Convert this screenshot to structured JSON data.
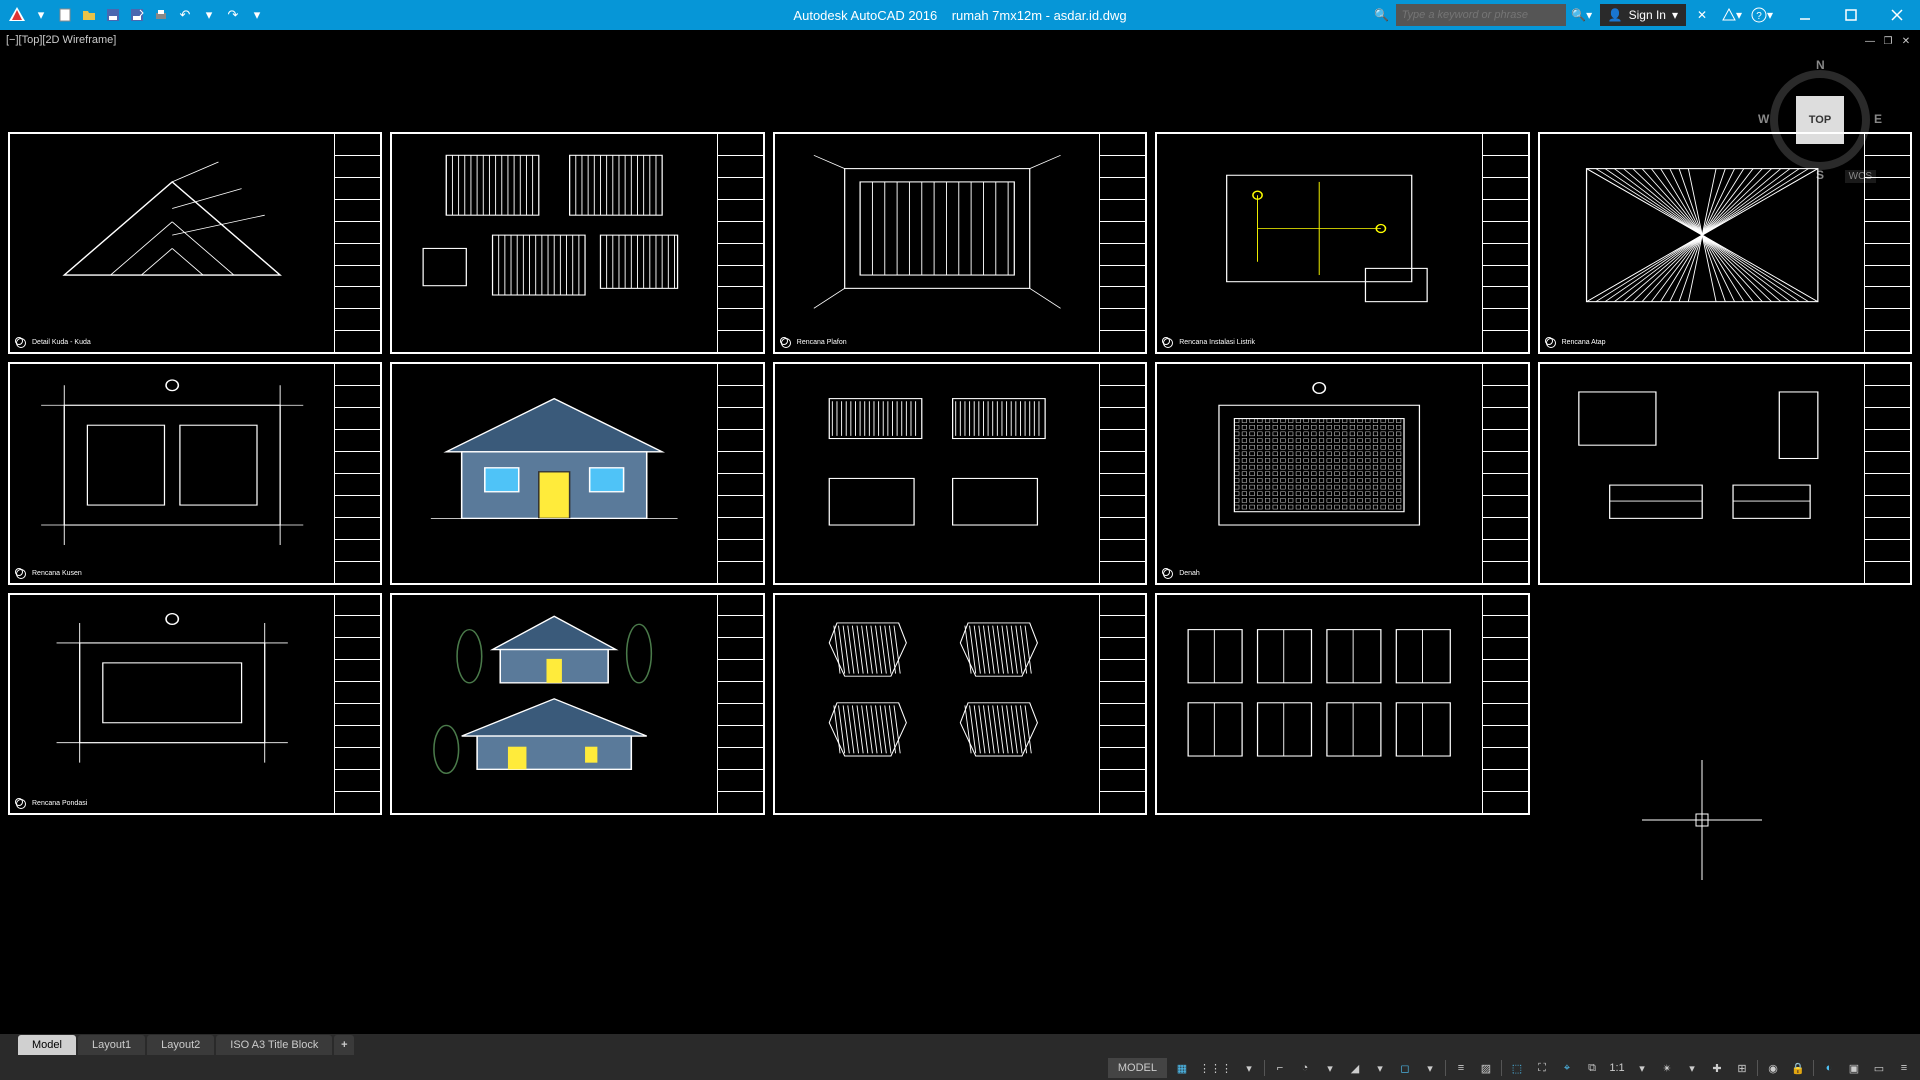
{
  "titlebar": {
    "app_name": "Autodesk AutoCAD 2016",
    "file_name": "rumah 7mx12m - asdar.id.dwg",
    "search_placeholder": "Type a keyword or phrase",
    "sign_in": "Sign In"
  },
  "viewport": {
    "label": "[−][Top][2D Wireframe]"
  },
  "viewcube": {
    "face": "TOP",
    "n": "N",
    "s": "S",
    "e": "E",
    "w": "W",
    "wcs": "WCS"
  },
  "sheets": [
    {
      "caption": "Detail Kuda - Kuda"
    },
    {
      "caption": ""
    },
    {
      "caption": "Rencana Plafon"
    },
    {
      "caption": "Rencana Instalasi Listrik"
    },
    {
      "caption": "Rencana Atap"
    },
    {
      "caption": "Rencana Kusen"
    },
    {
      "caption": ""
    },
    {
      "caption": ""
    },
    {
      "caption": "Denah"
    },
    {
      "caption": ""
    },
    {
      "caption": "Rencana Pondasi"
    },
    {
      "caption": ""
    },
    {
      "caption": ""
    },
    {
      "caption": ""
    },
    {
      "caption": ""
    }
  ],
  "tabs": {
    "items": [
      "Model",
      "Layout1",
      "Layout2",
      "ISO A3 Title Block"
    ],
    "active": 0,
    "add": "+"
  },
  "statusbar": {
    "model": "MODEL",
    "scale": "1:1"
  }
}
